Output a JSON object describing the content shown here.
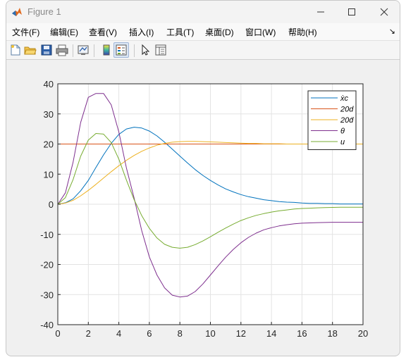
{
  "window": {
    "title": "Figure 1"
  },
  "menu": {
    "items": [
      "文件(F)",
      "编辑(E)",
      "查看(V)",
      "插入(I)",
      "工具(T)",
      "桌面(D)",
      "窗口(W)",
      "帮助(H)"
    ],
    "overflow_glyph": "↘"
  },
  "toolbar": {
    "icons": [
      "new-figure-icon",
      "open-file-icon",
      "save-icon",
      "print-icon",
      "link-plot-icon",
      "colorbar-icon",
      "legend-icon",
      "pointer-icon",
      "property-inspector-icon"
    ]
  },
  "chart_data": {
    "type": "line",
    "xlim": [
      0,
      20
    ],
    "ylim": [
      -40,
      40
    ],
    "xticks": [
      0,
      2,
      4,
      6,
      8,
      10,
      12,
      14,
      16,
      18,
      20
    ],
    "yticks": [
      -40,
      -30,
      -20,
      -10,
      0,
      10,
      20,
      30,
      40
    ],
    "grid": true,
    "legend_position": "top-right",
    "x": [
      0,
      0.5,
      1,
      1.5,
      2,
      2.5,
      3,
      3.5,
      4,
      4.5,
      5,
      5.5,
      6,
      6.5,
      7,
      7.5,
      8,
      8.5,
      9,
      9.5,
      10,
      10.5,
      11,
      11.5,
      12,
      12.5,
      13,
      13.5,
      14,
      14.5,
      15,
      15.5,
      16,
      16.5,
      17,
      17.5,
      18,
      18.5,
      19,
      19.5,
      20
    ],
    "series": [
      {
        "name": "ẋc",
        "color": "#0072BD",
        "values": [
          0,
          0.5,
          1.8,
          4.5,
          7.9,
          12.2,
          16.4,
          20.2,
          23.2,
          25,
          25.6,
          25.3,
          24.3,
          22.7,
          20.6,
          18.3,
          16,
          13.7,
          11.5,
          9.6,
          7.9,
          6.4,
          5.1,
          4.1,
          3.2,
          2.5,
          2,
          1.5,
          1.2,
          0.9,
          0.7,
          0.6,
          0.4,
          0.3,
          0.3,
          0.2,
          0.2,
          0.1,
          0.1,
          0.1,
          0.1
        ]
      },
      {
        "name": "20d",
        "color": "#D95319",
        "values": [
          20,
          20,
          20,
          20,
          20,
          20,
          20,
          20,
          20,
          20,
          20,
          20,
          20,
          20,
          20,
          20,
          20,
          20,
          20,
          20,
          20,
          20,
          20,
          20,
          20,
          20,
          20,
          20,
          20,
          20,
          20,
          20,
          20,
          20,
          20,
          20,
          20,
          20,
          20,
          20,
          20
        ]
      },
      {
        "name": "20ḋ",
        "color": "#EDB120",
        "values": [
          0,
          0.4,
          1.3,
          2.8,
          4.6,
          6.6,
          8.7,
          10.8,
          12.8,
          14.6,
          16.2,
          17.6,
          18.7,
          19.6,
          20.2,
          20.6,
          20.8,
          20.9,
          20.9,
          20.8,
          20.7,
          20.6,
          20.5,
          20.4,
          20.3,
          20.2,
          20.2,
          20.1,
          20.1,
          20.1,
          20,
          20,
          20,
          20,
          20,
          20,
          20,
          20,
          20,
          20,
          20
        ]
      },
      {
        "name": "θ",
        "color": "#7E2F8E",
        "values": [
          0,
          3.8,
          14,
          27.2,
          35.5,
          36.8,
          36.8,
          33,
          24,
          12,
          2,
          -8.8,
          -17.5,
          -23.5,
          -27.8,
          -30.2,
          -30.8,
          -30.5,
          -29,
          -26.5,
          -23.5,
          -20.5,
          -17.6,
          -15,
          -12.8,
          -11,
          -9.6,
          -8.5,
          -7.8,
          -7.2,
          -6.8,
          -6.5,
          -6.3,
          -6.2,
          -6.1,
          -6.05,
          -6,
          -6,
          -6,
          -6,
          -6
        ]
      },
      {
        "name": "u",
        "color": "#77AC30",
        "values": [
          0,
          2.2,
          8.2,
          16,
          21.3,
          23.5,
          23.3,
          20.5,
          15,
          8,
          1.5,
          -3.8,
          -8,
          -11.2,
          -13.3,
          -14.3,
          -14.6,
          -14.3,
          -13.4,
          -12.2,
          -10.8,
          -9.3,
          -7.9,
          -6.6,
          -5.4,
          -4.5,
          -3.7,
          -3.1,
          -2.6,
          -2.2,
          -1.9,
          -1.6,
          -1.4,
          -1.3,
          -1.2,
          -1.1,
          -1.05,
          -1,
          -1,
          -1,
          -1
        ]
      }
    ]
  }
}
